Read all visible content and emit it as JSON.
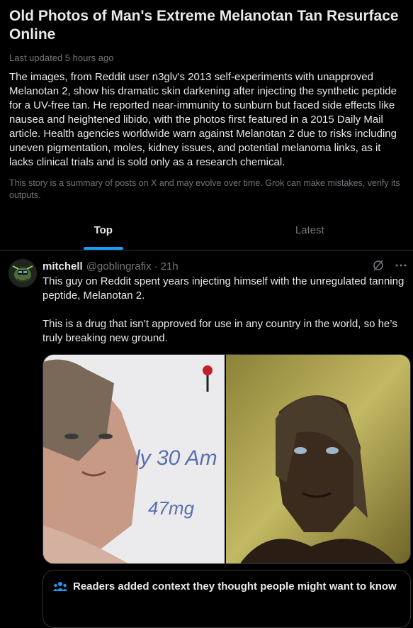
{
  "story": {
    "title": "Old Photos of Man's Extreme Melanotan Tan Resurface Online",
    "updated": "Last updated 5 hours ago",
    "summary": "The images, from Reddit user n3glv's 2013 self-experiments with unapproved Melanotan 2, show his dramatic skin darkening after injecting the synthetic peptide for a UV-free tan. He reported near-immunity to sunburn but faced side effects like nausea and heightened libido, with the photos first featured in a 2015 Daily Mail article. Health agencies worldwide warn against Melanotan 2 due to risks including uneven pigmentation, moles, kidney issues, and potential melanoma links, as it lacks clinical trials and is sold only as a research chemical.",
    "disclaimer": "This story is a summary of posts on X and may evolve over time. Grok can make mistakes, verify its outputs."
  },
  "tabs": [
    {
      "label": "Top",
      "active": true
    },
    {
      "label": "Latest",
      "active": false
    }
  ],
  "post": {
    "name": "mitchell",
    "handle": "@goblingrafix",
    "time": "21h",
    "text": "This guy on Reddit spent years injecting himself with the unregulated tanning peptide, Melanotan 2.\n\nThis is a drug that isn’t approved for use in any country in the world, so he’s truly breaking new ground.",
    "photo_left_writing": [
      "ly 30 Am",
      "47mg"
    ]
  },
  "context": {
    "label": "Readers added context they thought people might want to know"
  },
  "colors": {
    "accent": "#1d9bf0",
    "background": "#000000",
    "muted": "#71767b",
    "border": "#2f3336"
  },
  "icons": {
    "grok": "grok-icon",
    "more": "more-icon",
    "community_notes": "community-notes-icon"
  }
}
